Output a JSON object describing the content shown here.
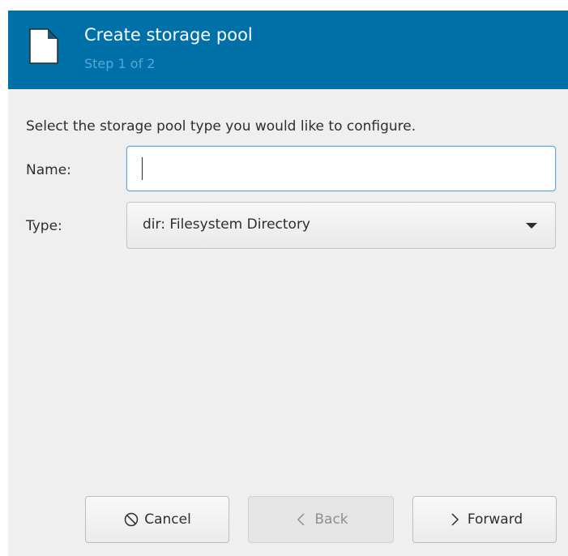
{
  "dialog": {
    "title": "Create storage pool",
    "step": "Step 1 of 2",
    "icon": "document-icon",
    "header_color": "#0070a9"
  },
  "form": {
    "instruction": "Select the storage pool type you would like to configure.",
    "name_label": "Name:",
    "name_value": "",
    "type_label": "Type:",
    "type_selected": "dir: Filesystem Directory"
  },
  "buttons": {
    "cancel": {
      "label": "Cancel",
      "icon": "cancel-icon",
      "enabled": true
    },
    "back": {
      "label": "Back",
      "icon": "chevron-left-icon",
      "enabled": false
    },
    "forward": {
      "label": "Forward",
      "icon": "chevron-right-icon",
      "enabled": true
    }
  }
}
